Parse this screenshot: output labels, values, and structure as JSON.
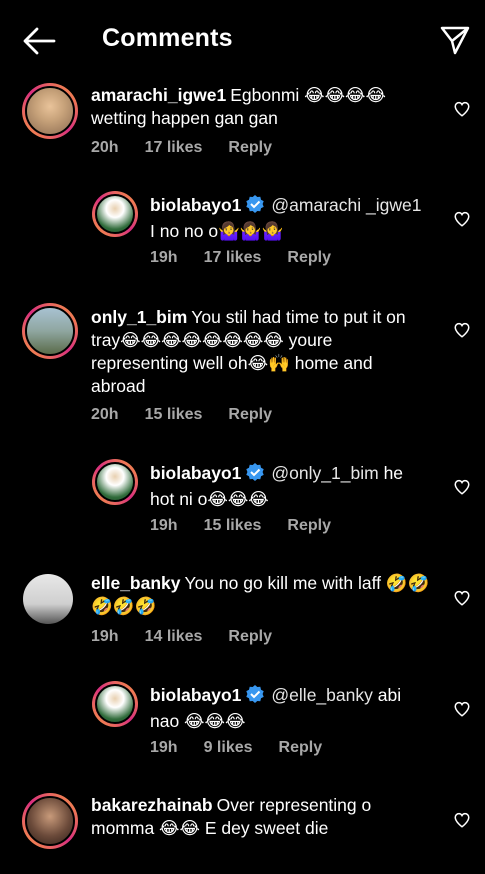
{
  "header": {
    "title": "Comments"
  },
  "comments": [
    {
      "username": "amarachi_igwe1",
      "text": "Egbonmi 😂😂😂😂 wetting happen gan gan",
      "time": "20h",
      "likes": "17 likes",
      "reply": "Reply",
      "avatar_color": "#c7a27a"
    },
    {
      "username": "biolabayo1",
      "mention": "@amarachi _igwe1",
      "text": "I no no o🤷‍♀️🤷‍♀️🤷‍♀️",
      "time": "19h",
      "likes": "17 likes",
      "reply": "Reply",
      "avatar_color": "#2f6b3a"
    },
    {
      "username": "only_1_bim",
      "text": "You stil had time to put it on tray😂😂😂😂😂😂😂😂 youre representing well oh😂🙌 home and abroad",
      "time": "20h",
      "likes": "15 likes",
      "reply": "Reply",
      "avatar_color": "#8fa6a0"
    },
    {
      "username": "biolabayo1",
      "mention": "@only_1_bim",
      "text": "he hot ni o😂😂😂",
      "time": "19h",
      "likes": "15 likes",
      "reply": "Reply",
      "avatar_color": "#2f6b3a"
    },
    {
      "username": "elle_banky",
      "text": "You no go kill me with laff 🤣🤣🤣🤣🤣",
      "time": "19h",
      "likes": "14 likes",
      "reply": "Reply",
      "avatar_color": "#d8d8d8"
    },
    {
      "username": "biolabayo1",
      "mention": "@elle_banky",
      "text": "abi nao 😂😂😂",
      "time": "19h",
      "likes": "9 likes",
      "reply": "Reply",
      "avatar_color": "#2f6b3a"
    },
    {
      "username": "bakarezhainab",
      "text": "Over representing o momma 😂😂 E dey sweet die",
      "avatar_color": "#6b4a3a"
    }
  ]
}
